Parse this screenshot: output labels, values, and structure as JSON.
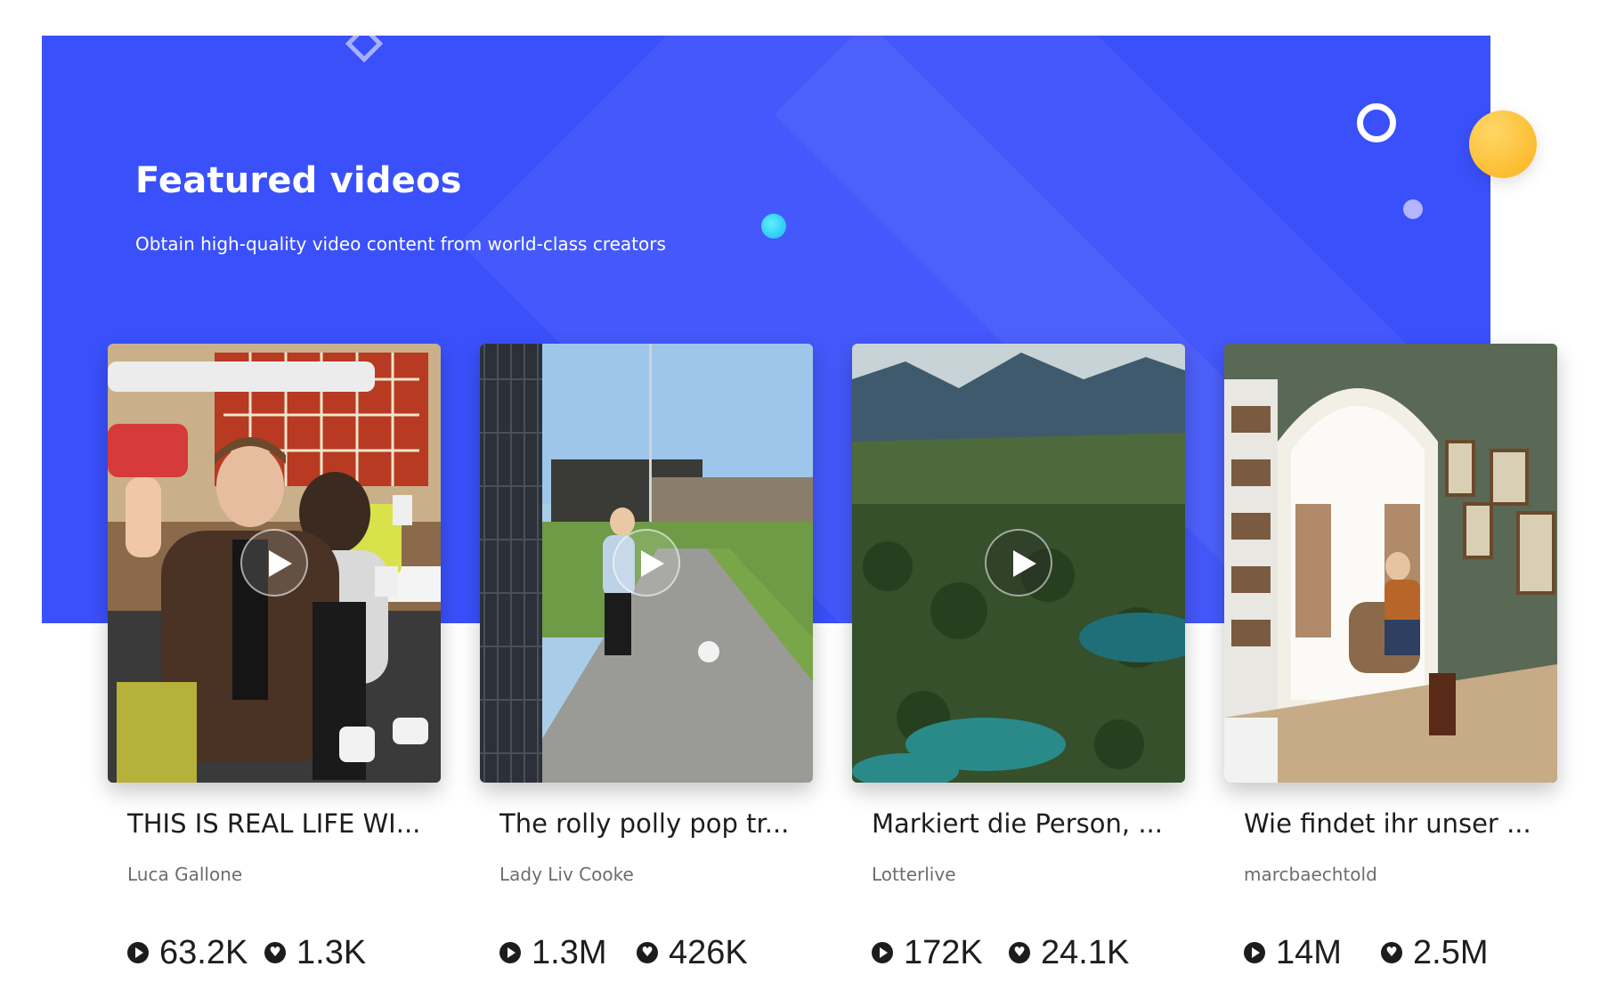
{
  "hero": {
    "title": "Featured videos",
    "subtitle": "Obtain high-quality video content from world-class creators",
    "colors": {
      "background": "#3a50fb",
      "accent_yellow": "#fbb21c",
      "accent_cyan": "#19b8f0"
    }
  },
  "videos": [
    {
      "title": "THIS IS REAL LIFE WI...",
      "author": "Luca Gallone",
      "views": "63.2K",
      "likes": "1.3K"
    },
    {
      "title": "The rolly polly pop tr...",
      "author": "Lady Liv Cooke",
      "views": "1.3M",
      "likes": "426K"
    },
    {
      "title": "Markiert die Person, ...",
      "author": "Lotterlive",
      "views": "172K",
      "likes": "24.1K"
    },
    {
      "title": "Wie findet ihr unser ...",
      "author": "marcbaechtold",
      "views": "14M",
      "likes": "2.5M"
    }
  ],
  "icons": {
    "views": "play-circle-icon",
    "likes": "heart-circle-icon",
    "thumbnail_overlay": "play-icon"
  }
}
